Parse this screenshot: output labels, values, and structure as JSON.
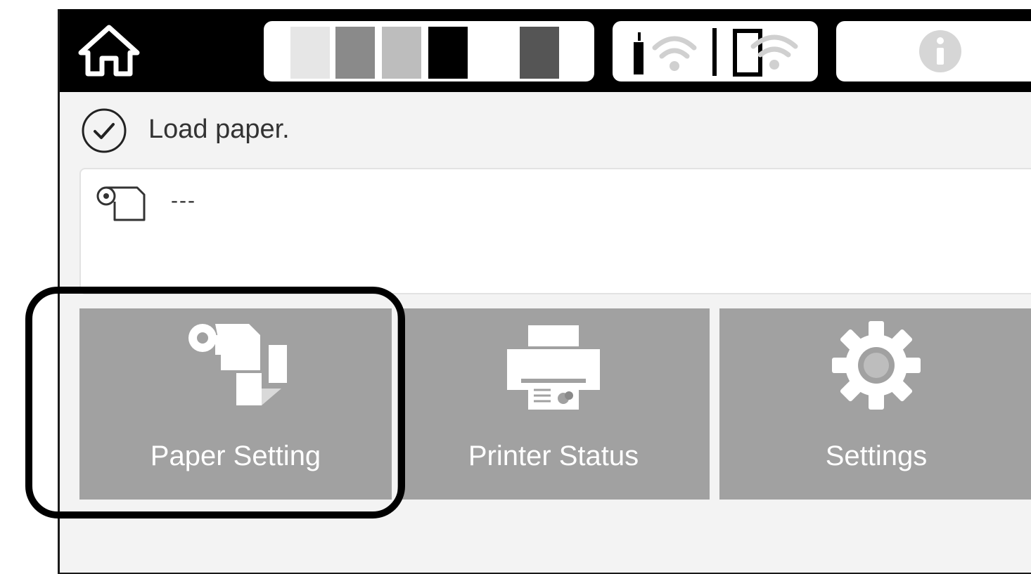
{
  "status": {
    "message": "Load paper."
  },
  "paper": {
    "value": "---"
  },
  "ink_levels": [
    {
      "color": "#e6e6e6",
      "level": 1.0
    },
    {
      "color": "#8a8a8a",
      "level": 1.0
    },
    {
      "color": "#bdbdbd",
      "level": 1.0
    },
    {
      "color": "#000000",
      "level": 1.0
    },
    {
      "color": "#ffffff",
      "level": 1.0
    },
    {
      "color": "#555555",
      "level": 1.0
    }
  ],
  "menu": {
    "paper_setting": "Paper Setting",
    "printer_status": "Printer Status",
    "settings": "Settings"
  },
  "icons": {
    "home": "home-icon",
    "network": "wifi-icon",
    "info": "info-icon",
    "status": "check-circle-icon",
    "paper_roll": "paper-roll-icon",
    "paper_setting": "paper-setting-icon",
    "printer_status": "printer-icon",
    "settings": "gear-icon"
  }
}
